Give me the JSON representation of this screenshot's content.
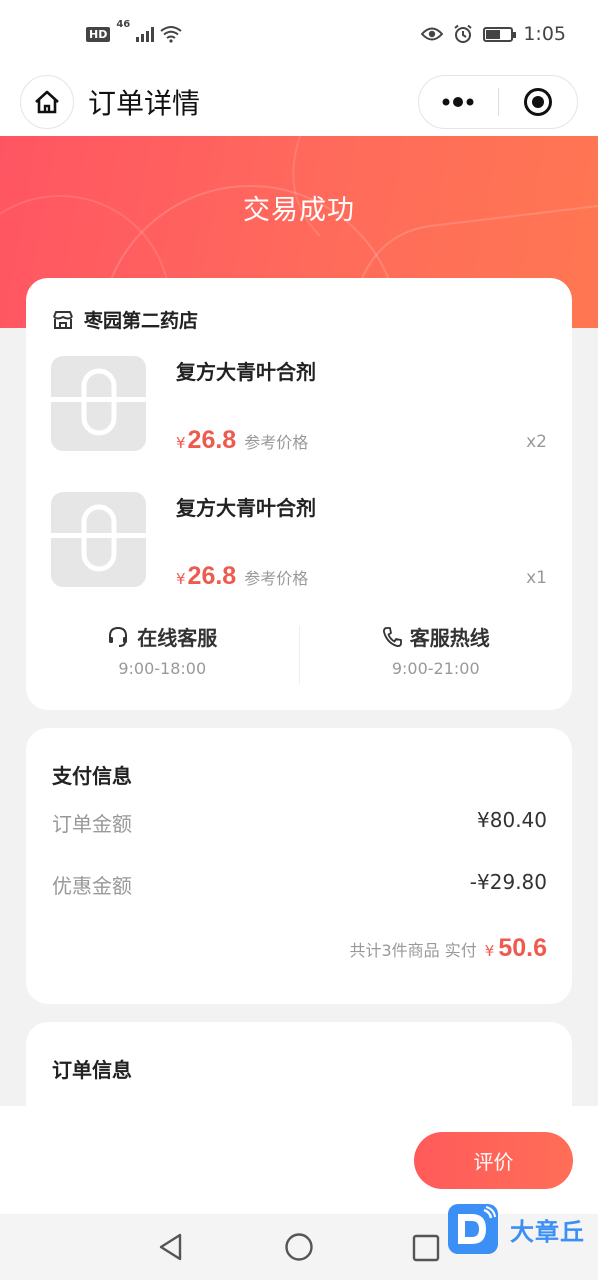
{
  "status_bar": {
    "hd": "HD",
    "network": "46",
    "time": "1:05",
    "battery_level": 0.55
  },
  "nav": {
    "title": "订单详情",
    "home_icon": "home-icon",
    "more_icon": "more-dots-icon",
    "close_icon": "target-circle-icon"
  },
  "banner": {
    "status": "交易成功"
  },
  "store": {
    "name": "枣园第二药店",
    "icon": "store-icon",
    "products": [
      {
        "name": "复方大青叶合剂",
        "currency": "¥",
        "price": "26.8",
        "price_note": "参考价格",
        "qty": "x2"
      },
      {
        "name": "复方大青叶合剂",
        "currency": "¥",
        "price": "26.8",
        "price_note": "参考价格",
        "qty": "x1"
      }
    ],
    "services": [
      {
        "label": "在线客服",
        "hours": "9:00-18:00",
        "icon": "headset-icon"
      },
      {
        "label": "客服热线",
        "hours": "9:00-21:00",
        "icon": "phone-icon"
      }
    ]
  },
  "payment": {
    "title": "支付信息",
    "rows": [
      {
        "label": "订单金额",
        "value": "¥80.40"
      },
      {
        "label": "优惠金额",
        "value": "-¥29.80"
      }
    ],
    "total_prefix": "共计3件商品 实付",
    "total_currency": "¥",
    "total_value": "50.6"
  },
  "order_info": {
    "title": "订单信息"
  },
  "bottom": {
    "review_label": "评价"
  },
  "watermark": {
    "text": "大章丘"
  },
  "colors": {
    "accent": "#ef5a4f",
    "banner_start": "#ff5563",
    "banner_end": "#ff7752",
    "watermark_blue": "#3b8ff5"
  }
}
